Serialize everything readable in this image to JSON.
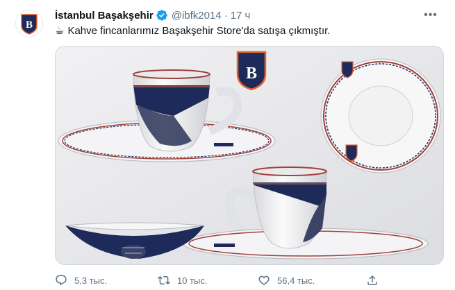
{
  "tweet": {
    "author_name": "İstanbul Başakşehir",
    "handle": "@ibfk2014",
    "separator": "·",
    "time": "17 ч",
    "emoji": "☕",
    "text": "Kahve fincanlarımız Başakşehir Store'da satışa çıkmıştır.",
    "more_label": "•••"
  },
  "media": {
    "badge_letter": "B",
    "description_icon": "coffee-cup-photo"
  },
  "actions": {
    "reply_count": "5,3 тыс.",
    "retweet_count": "10 тыс.",
    "like_count": "56,4 тыс."
  },
  "colors": {
    "brand_navy": "#1e2a5a",
    "brand_orange": "#e8632b",
    "verified_blue": "#1d9bf0",
    "muted_text": "#5b7083"
  }
}
